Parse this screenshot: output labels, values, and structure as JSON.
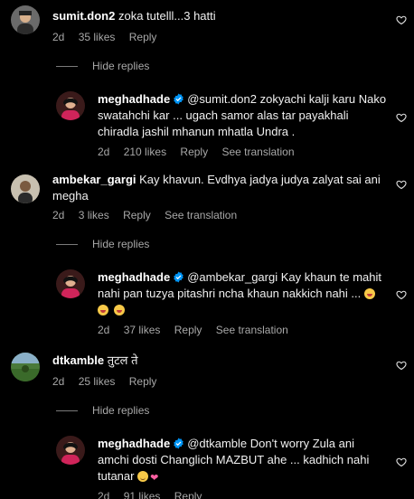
{
  "comments": [
    {
      "username": "sumit.don2",
      "text": "zoka tutelll...3 hatti",
      "age": "2d",
      "likes": "35 likes",
      "reply_label": "Reply"
    },
    {
      "username": "ambekar_gargi",
      "text": "Kay khavun. Evdhya jadya judya zalyat sai ani megha",
      "age": "2d",
      "likes": "3 likes",
      "reply_label": "Reply",
      "translation_label": "See translation"
    },
    {
      "username": "dtkamble",
      "text": "तुटल ते",
      "age": "2d",
      "likes": "25 likes",
      "reply_label": "Reply"
    }
  ],
  "replies": [
    {
      "username": "meghadhade",
      "mention": "@sumit.don2",
      "text": "zokyachi kalji karu Nako swatahchi kar ... ugach samor alas tar payakhali chiradla jashil mhanun mhatla Undra .",
      "age": "2d",
      "likes": "210 likes",
      "reply_label": "Reply",
      "translation_label": "See translation"
    },
    {
      "username": "meghadhade",
      "mention": "@ambekar_gargi",
      "text": "Kay khaun te mahit nahi pan tuzya pitashri ncha khaun nakkich nahi ...",
      "age": "2d",
      "likes": "37 likes",
      "reply_label": "Reply",
      "translation_label": "See translation"
    },
    {
      "username": "meghadhade",
      "mention": "@dtkamble",
      "text": "Don't worry Zula ani amchi dosti Changlich MAZBUT ahe ... kadhich nahi tutanar",
      "age": "2d",
      "likes": "91 likes",
      "reply_label": "Reply"
    }
  ],
  "hide_replies_label": "Hide replies",
  "colors": {
    "background": "#000000",
    "verified": "#0095f6",
    "muted": "#a8a8a8"
  },
  "icons": [
    "heart-icon",
    "verified-badge-icon"
  ]
}
